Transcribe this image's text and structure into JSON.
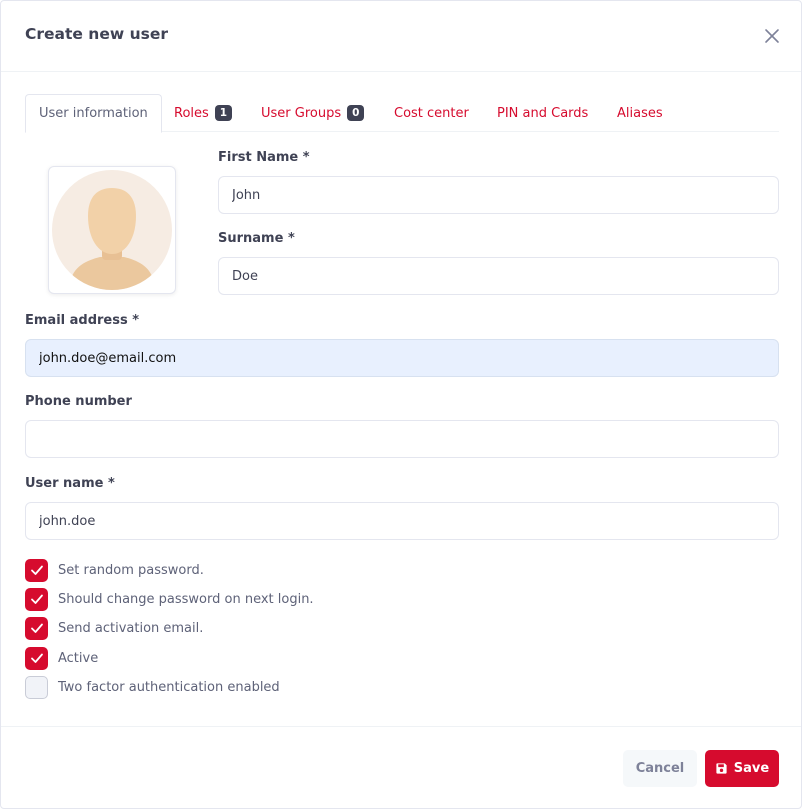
{
  "dialog": {
    "title": "Create new user"
  },
  "tabs": [
    {
      "label": "User information",
      "active": true
    },
    {
      "label": "Roles",
      "badge": "1"
    },
    {
      "label": "User Groups",
      "badge": "0"
    },
    {
      "label": "Cost center"
    },
    {
      "label": "PIN and Cards"
    },
    {
      "label": "Aliases"
    }
  ],
  "form": {
    "first_name": {
      "label": "First Name *",
      "value": "John"
    },
    "surname": {
      "label": "Surname *",
      "value": "Doe"
    },
    "email": {
      "label": "Email address *",
      "value": "john.doe@email.com"
    },
    "phone": {
      "label": "Phone number",
      "value": ""
    },
    "username": {
      "label": "User name *",
      "value": "john.doe"
    }
  },
  "options": [
    {
      "label": "Set random password.",
      "checked": true
    },
    {
      "label": "Should change password on next login.",
      "checked": true
    },
    {
      "label": "Send activation email.",
      "checked": true
    },
    {
      "label": "Active",
      "checked": true
    },
    {
      "label": "Two factor authentication enabled",
      "checked": false
    }
  ],
  "footer": {
    "cancel_label": "Cancel",
    "save_label": "Save"
  },
  "colors": {
    "accent": "#d60b2e",
    "badge": "#3f4254",
    "autofill_bg": "#e8f0fe"
  },
  "icons": {
    "close": "close-icon",
    "avatar": "avatar-placeholder",
    "check": "check-icon",
    "save": "floppy-disk-icon"
  }
}
